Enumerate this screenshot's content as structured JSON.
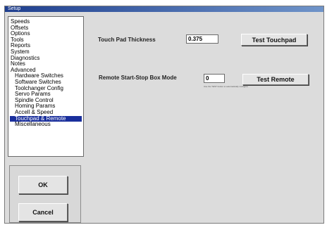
{
  "window": {
    "title": "Setup"
  },
  "tree": {
    "items": [
      {
        "label": "Speeds",
        "child": false,
        "selected": false
      },
      {
        "label": "Offsets",
        "child": false,
        "selected": false
      },
      {
        "label": "Options",
        "child": false,
        "selected": false
      },
      {
        "label": "Tools",
        "child": false,
        "selected": false
      },
      {
        "label": "Reports",
        "child": false,
        "selected": false
      },
      {
        "label": "System",
        "child": false,
        "selected": false
      },
      {
        "label": "Diagnostics",
        "child": false,
        "selected": false
      },
      {
        "label": "Notes",
        "child": false,
        "selected": false
      },
      {
        "label": "Advanced",
        "child": false,
        "selected": false
      },
      {
        "label": "Hardware Switches",
        "child": true,
        "selected": false
      },
      {
        "label": "Software Switches",
        "child": true,
        "selected": false
      },
      {
        "label": "Toolchanger Config",
        "child": true,
        "selected": false
      },
      {
        "label": "Servo Params",
        "child": true,
        "selected": false
      },
      {
        "label": "Spindle Control",
        "child": true,
        "selected": false
      },
      {
        "label": "Homing Params",
        "child": true,
        "selected": false
      },
      {
        "label": "Accell & Speed",
        "child": true,
        "selected": false
      },
      {
        "label": "Touchpad & Remote",
        "child": true,
        "selected": true
      },
      {
        "label": "Miscellaneous",
        "child": true,
        "selected": false
      }
    ]
  },
  "buttons": {
    "ok": "OK",
    "cancel": "Cancel"
  },
  "touchpad": {
    "label": "Touch Pad Thickness",
    "value": "0.375",
    "test_button": "Test Touchpad"
  },
  "remote": {
    "label": "Remote Start-Stop Box Mode",
    "value": "0",
    "test_button": "Test Remote",
    "hint": "Use the TEST button to automatically configure"
  }
}
